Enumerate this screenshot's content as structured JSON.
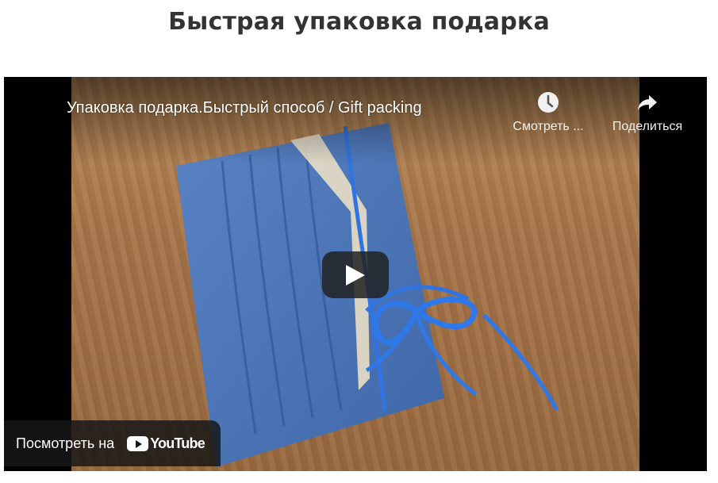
{
  "page": {
    "title": "Быстрая упаковка подарка"
  },
  "video": {
    "title": "Упаковка подарка.Быстрый способ / Gift packing",
    "actions": [
      {
        "label": "Смотреть ...",
        "icon": "clock-icon"
      },
      {
        "label": "Поделиться",
        "icon": "share-icon"
      }
    ],
    "play_icon": "play-icon",
    "watch_on": {
      "label": "Посмотреть на",
      "brand": "YouTube"
    }
  },
  "colors": {
    "title_text": "#333333",
    "player_bg": "#000000",
    "gift_blue": "#4a73b6",
    "wood": "#b98a58"
  }
}
